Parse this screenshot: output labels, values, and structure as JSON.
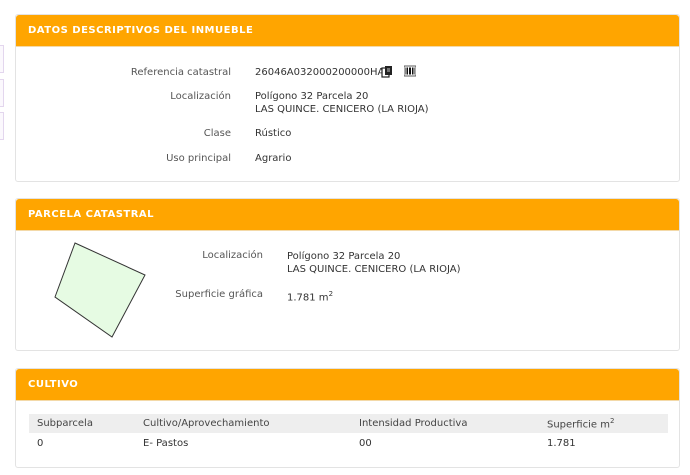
{
  "inmueble": {
    "header": "DATOS DESCRIPTIVOS DEL INMUEBLE",
    "ref_label": "Referencia catastral",
    "ref_value": "26046A032000200000HA",
    "loc_label": "Localización",
    "loc_line1": "Polígono 32 Parcela 20",
    "loc_line2": "LAS QUINCE. CENICERO (LA RIOJA)",
    "clase_label": "Clase",
    "clase_value": "Rústico",
    "uso_label": "Uso principal",
    "uso_value": "Agrario",
    "icons": [
      "copy-icon",
      "barcode-icon"
    ]
  },
  "parcela": {
    "header": "PARCELA CATASTRAL",
    "loc_label": "Localización",
    "loc_line1": "Polígono 32 Parcela 20",
    "loc_line2": "LAS QUINCE. CENICERO (LA RIOJA)",
    "sup_label": "Superficie gráfica",
    "sup_value": "1.781 m",
    "sup_exp": "2",
    "shape_fill": "#e6fbe3",
    "shape_stroke": "#333333"
  },
  "cultivo": {
    "header": "CULTIVO",
    "columns": [
      "Subparcela",
      "Cultivo/Aprovechamiento",
      "Intensidad Productiva",
      "Superficie m"
    ],
    "col_exp": "2",
    "rows": [
      [
        "0",
        "E- Pastos",
        "00",
        "1.781"
      ]
    ]
  },
  "colors": {
    "accent": "#ffa500",
    "table_header": "#eeeeee"
  }
}
